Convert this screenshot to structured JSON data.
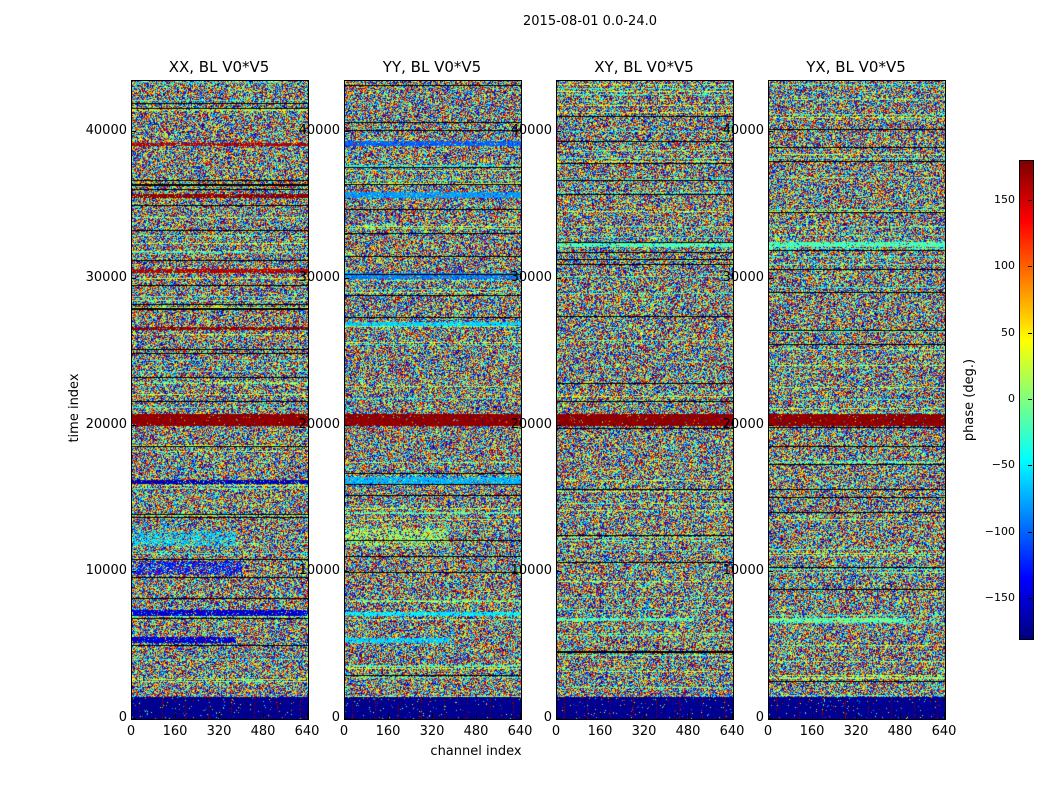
{
  "chart_data": {
    "type": "heatmap",
    "suptitle": "2015-08-01 0.0-24.0",
    "xlabel": "channel index",
    "ylabel": "time index",
    "xlim": [
      0,
      640
    ],
    "ylim": [
      0,
      43500
    ],
    "xticks": [
      0,
      160,
      320,
      480,
      640
    ],
    "yticks": [
      0,
      10000,
      20000,
      30000,
      40000
    ],
    "colorbar": {
      "label": "phase (deg.)",
      "range": [
        -180,
        180
      ],
      "ticks": [
        -150,
        -100,
        -50,
        0,
        50,
        100,
        150
      ],
      "colormap": "jet"
    },
    "panels": [
      {
        "title": "XX, BL V0*V5",
        "seed": 11,
        "bands": [
          {
            "y0": 0,
            "y1": 1500,
            "value": -175,
            "full": true
          },
          {
            "y0": 5200,
            "y1": 5600,
            "value": -150,
            "xmax": 380
          },
          {
            "y0": 7000,
            "y1": 7400,
            "value": -150
          },
          {
            "y0": 9800,
            "y1": 10800,
            "value": -130,
            "xmax": 400,
            "noise": 0.5
          },
          {
            "y0": 11800,
            "y1": 12800,
            "value": -60,
            "xmax": 380,
            "noise": 0.5
          },
          {
            "y0": 16000,
            "y1": 16300,
            "value": -160
          },
          {
            "y0": 20000,
            "y1": 20800,
            "value": 175,
            "full": true
          },
          {
            "y0": 26500,
            "y1": 26700,
            "value": 175
          },
          {
            "y0": 30400,
            "y1": 30700,
            "value": 160
          },
          {
            "y0": 35500,
            "y1": 35800,
            "value": 175
          },
          {
            "y0": 39100,
            "y1": 39300,
            "value": 160
          }
        ]
      },
      {
        "title": "YY, BL V0*V5",
        "seed": 23,
        "bands": [
          {
            "y0": 0,
            "y1": 1500,
            "value": -175,
            "full": true
          },
          {
            "y0": 5200,
            "y1": 5500,
            "value": -60,
            "xmax": 380
          },
          {
            "y0": 7000,
            "y1": 7300,
            "value": -50
          },
          {
            "y0": 11800,
            "y1": 13000,
            "value": 10,
            "xmax": 380,
            "noise": 0.5
          },
          {
            "y0": 16000,
            "y1": 16500,
            "value": -70
          },
          {
            "y0": 20000,
            "y1": 20800,
            "value": 175,
            "full": true
          },
          {
            "y0": 26800,
            "y1": 27100,
            "value": -60
          },
          {
            "y0": 30000,
            "y1": 30400,
            "value": -90
          },
          {
            "y0": 35500,
            "y1": 35900,
            "value": -80
          },
          {
            "y0": 39100,
            "y1": 39400,
            "value": -100
          }
        ]
      },
      {
        "title": "XY, BL V0*V5",
        "seed": 37,
        "bands": [
          {
            "y0": 0,
            "y1": 1500,
            "value": -175,
            "full": true
          },
          {
            "y0": 6700,
            "y1": 6900,
            "value": -20,
            "xmax": 500
          },
          {
            "y0": 20000,
            "y1": 20800,
            "value": 175,
            "full": true
          },
          {
            "y0": 32200,
            "y1": 32500,
            "value": -20
          }
        ]
      },
      {
        "title": "YX, BL V0*V5",
        "seed": 53,
        "bands": [
          {
            "y0": 0,
            "y1": 1500,
            "value": -175,
            "full": true
          },
          {
            "y0": 6600,
            "y1": 6900,
            "value": -10,
            "xmax": 500
          },
          {
            "y0": 20000,
            "y1": 20800,
            "value": 175,
            "full": true
          },
          {
            "y0": 32200,
            "y1": 32500,
            "value": -20
          }
        ]
      }
    ]
  }
}
